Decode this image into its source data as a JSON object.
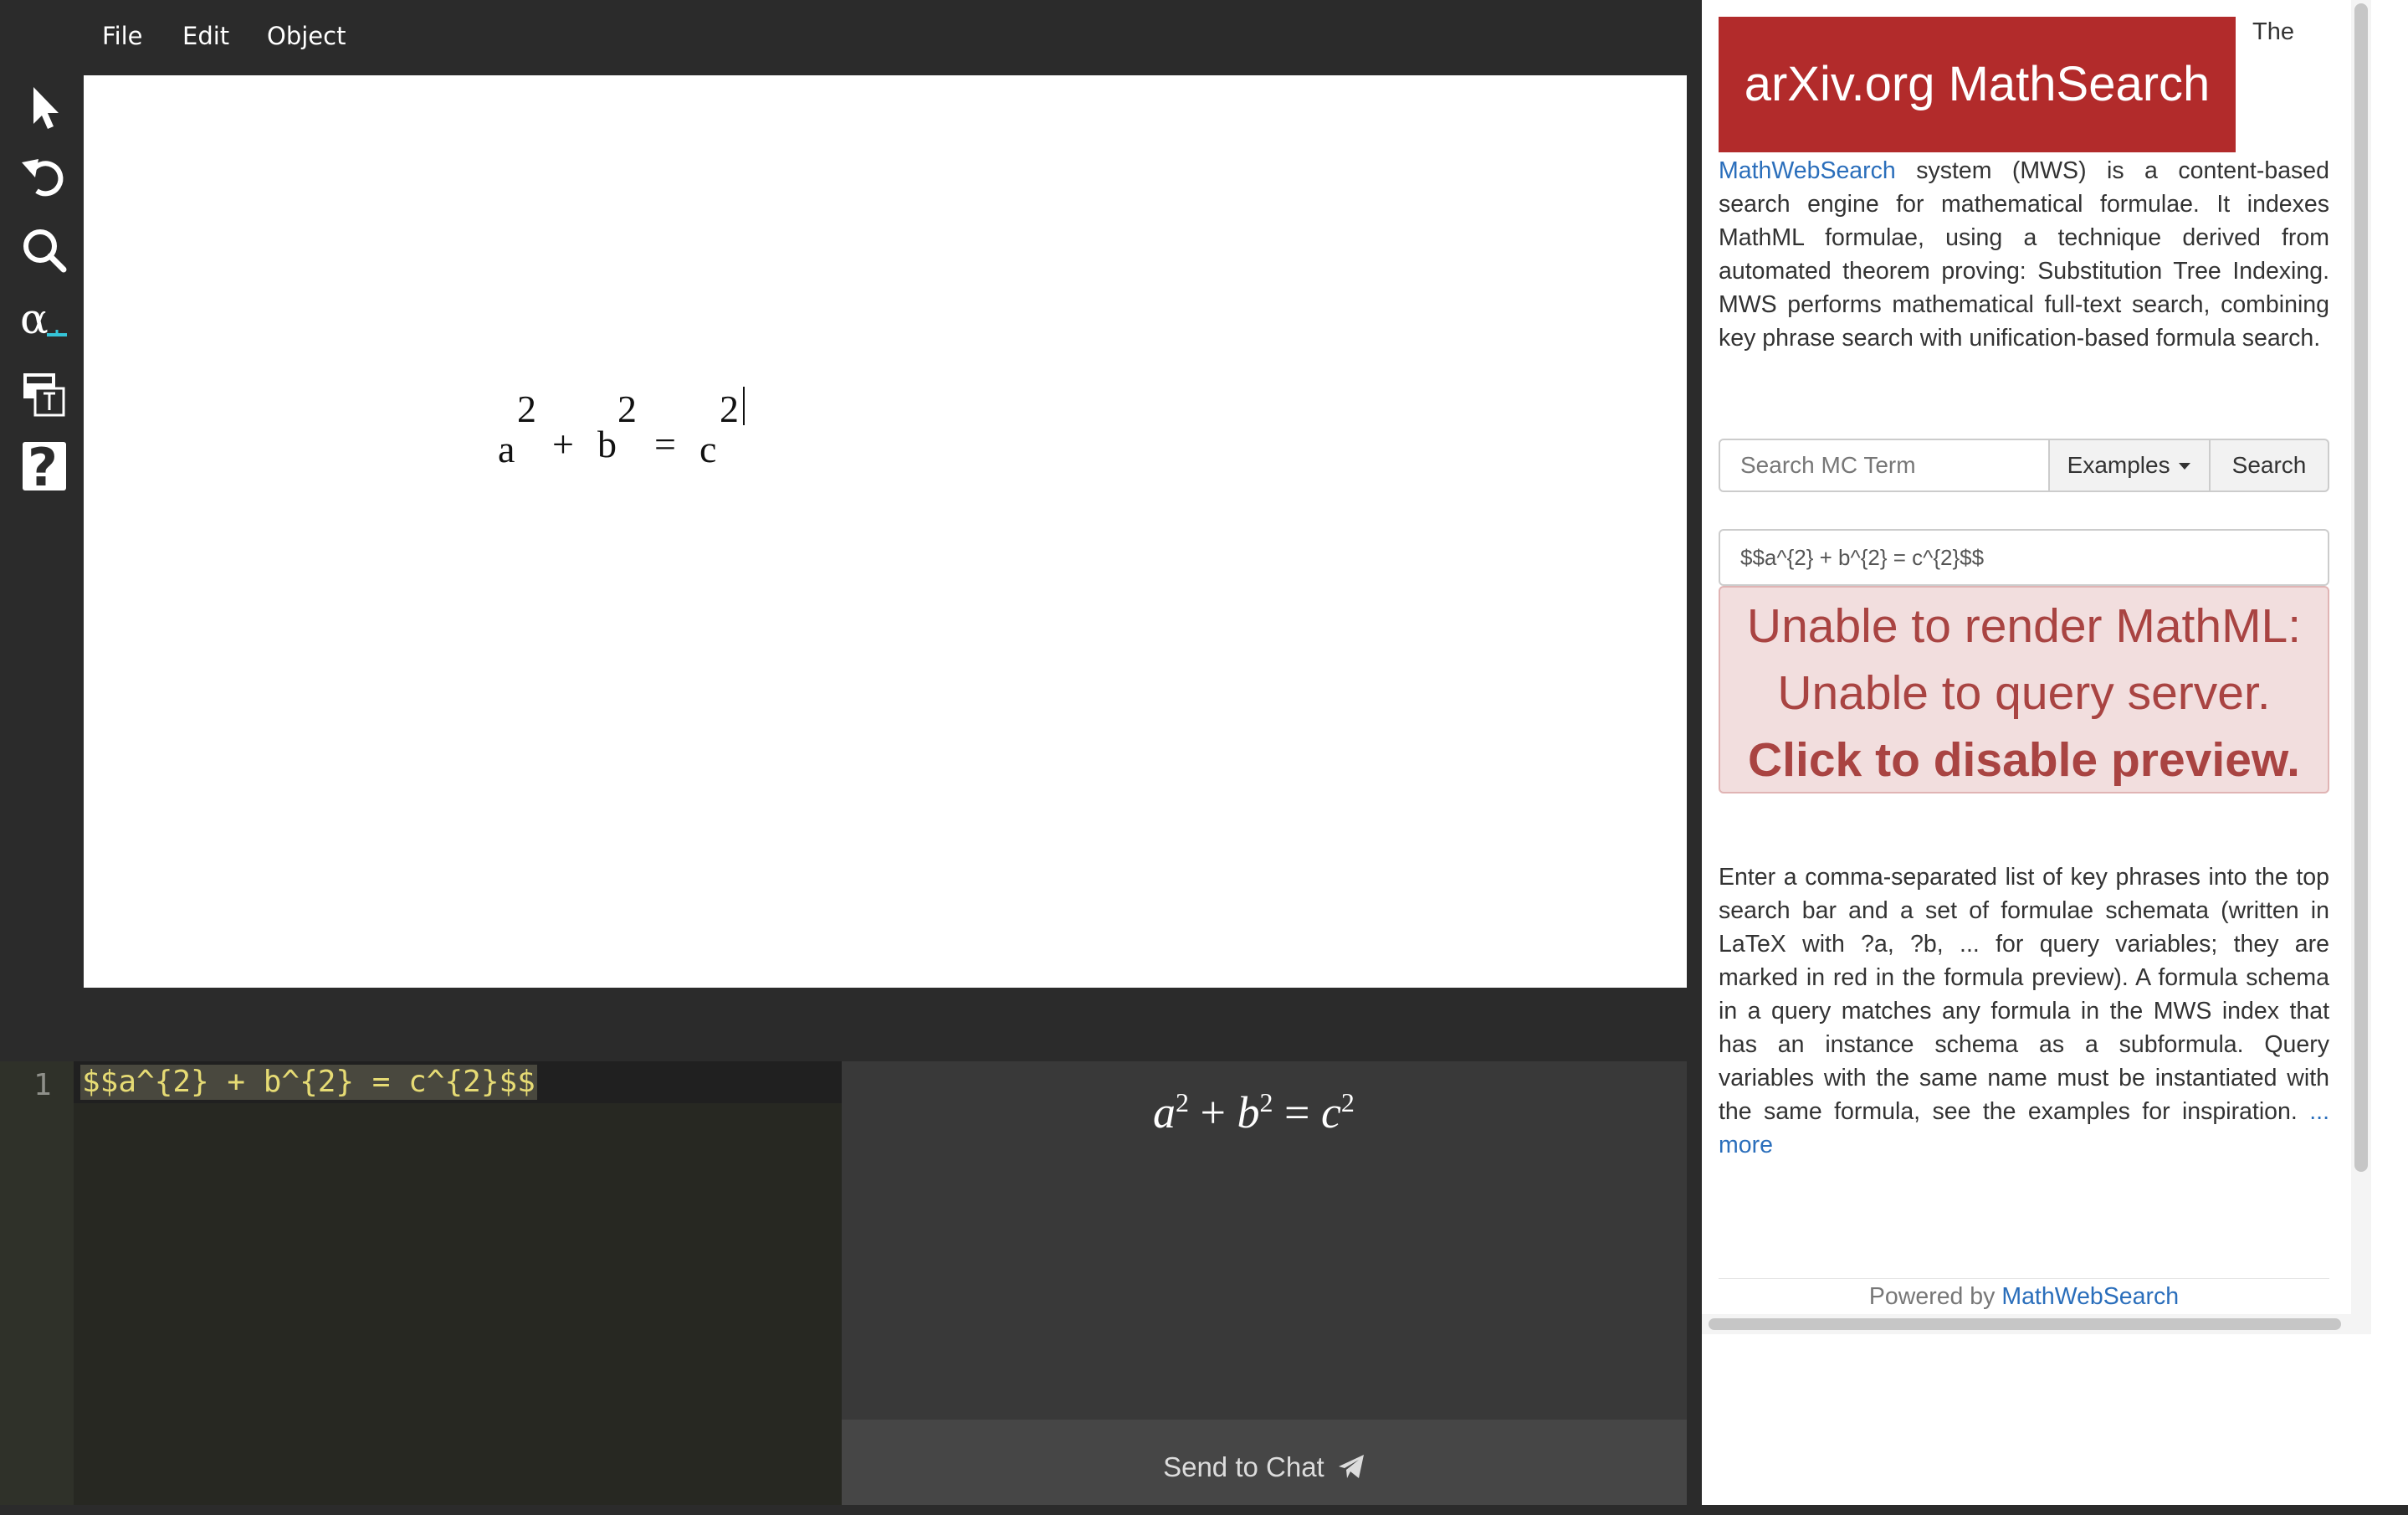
{
  "menu": {
    "file": "File",
    "edit": "Edit",
    "object": "Object"
  },
  "toolbar": {
    "tools": [
      "pointer-icon",
      "undo-icon",
      "magnifier-icon",
      "symbol-alpha-icon",
      "convert-icon",
      "help-icon"
    ],
    "alpha_glyph": "α",
    "help_glyph": "?"
  },
  "canvas": {
    "base_a": "a",
    "sup_a": "2",
    "plus": "+",
    "base_b": "b",
    "sup_b": "2",
    "equals": "=",
    "base_c": "c",
    "sup_c": "2"
  },
  "editor": {
    "line_number": "1",
    "code": "$$a^{2} + b^{2} = c^{2}$$"
  },
  "preview": {
    "a": "a",
    "b": "b",
    "c": "c",
    "exp": "2",
    "plus": "+",
    "equals": "="
  },
  "send": {
    "label": "Send to Chat"
  },
  "panel": {
    "brand": "arXiv.org MathSearch",
    "the": "The",
    "intro_link": "MathWebSearch",
    "intro_text": " system (MWS) is a content-based search engine for mathematical formulae. It indexes MathML formulae, using a technique derived from automated theorem proving: Substitution Tree Indexing. MWS performs mathematical full-text search, combining key phrase search with unification-based formula search.",
    "search_placeholder": "Search MC Term",
    "examples_label": "Examples",
    "search_label": "Search",
    "formula_value": "$$a^{2} + b^{2} = c^{2}$$",
    "error_line1": "Unable to render MathML:",
    "error_line2": "Unable to query server.",
    "error_line3": "Click to disable preview.",
    "help_text": "Enter a comma-separated list of key phrases into the top search bar and a set of formulae schemata (written in LaTeX with ?a, ?b, ... for query variables; they are marked in red in the formula preview). A formula schema in a query matches any formula in the MWS index that has an instance schema as a subformula. Query variables with the same name must be instantiated with the same formula, see the examples for inspiration.",
    "more_link": "... more",
    "powered_by": "Powered by ",
    "powered_link": "MathWebSearch"
  },
  "colors": {
    "brand": "#b22b2b",
    "link": "#2a6ebb",
    "error_bg": "#f2dede",
    "error_text": "#a94442",
    "code_string": "#e6db74",
    "chrome": "#2b2b2b"
  }
}
